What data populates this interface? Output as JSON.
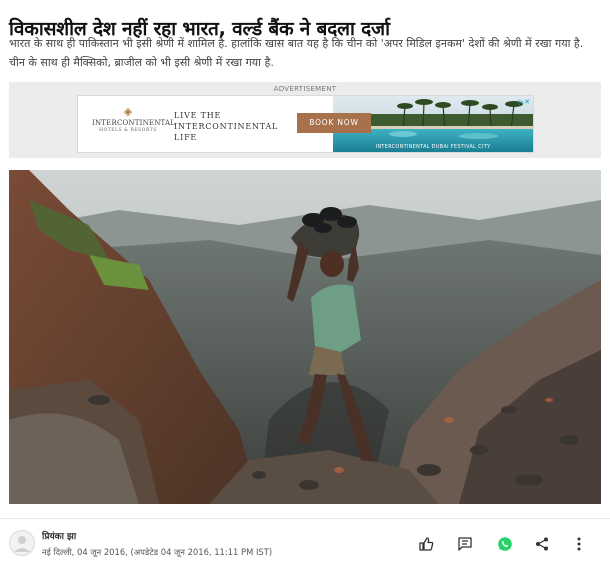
{
  "article": {
    "headline": "विकासशील देश नहीं रहा भारत, वर्ल्ड बैंक ने बदला दर्जा",
    "summary": "भारत के साथ ही पाकिस्तान भी इसी श्रेणी में शामिल है. हालांकि खास बात यह है कि चीन को 'अपर मिडिल इनकम' देशों की श्रेणी में रखा गया है. चीन के साथ ही मैक्सिको, ब्राजील को भी इसी श्रेणी में रखा गया है."
  },
  "ad": {
    "label": "ADVERTISEMENT",
    "brand": "INTERCONTINENTAL",
    "brand_sub": "HOTELS & RESORTS",
    "tagline_1": "LIVE THE",
    "tagline_2": "INTERCONTINENTAL LIFE",
    "cta": "BOOK NOW",
    "caption": "INTERCONTINENTAL DUBAI FESTIVAL CITY",
    "brand_color": "#a6714b"
  },
  "byline": {
    "author": "प्रियंका झा",
    "dateline": "नई दिल्ली, 04 जून 2016, (अपडेटेड 04 जून 2016, 11:11 PM IST)"
  },
  "actions": {
    "icons": [
      "thumbs-up-icon",
      "comment-icon",
      "whatsapp-icon",
      "share-icon",
      "more-vertical-icon"
    ],
    "whatsapp_color": "#25d366"
  }
}
